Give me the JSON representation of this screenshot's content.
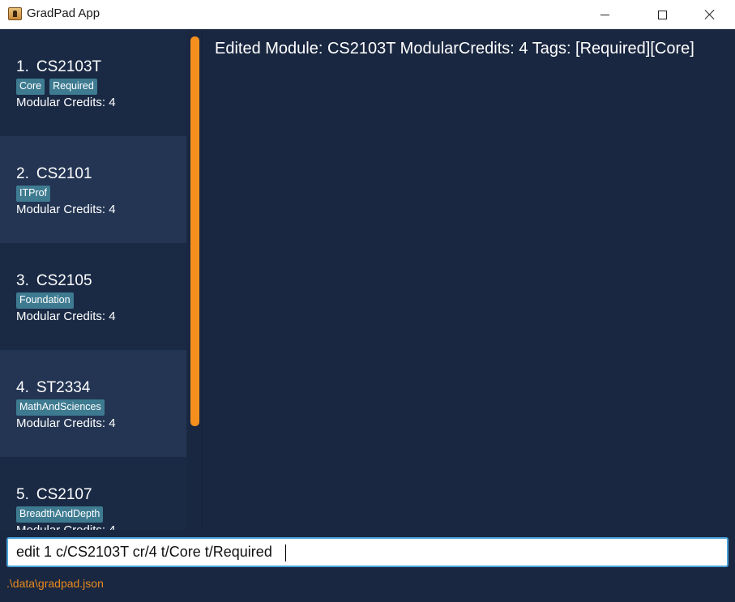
{
  "window": {
    "title": "GradPad App"
  },
  "modules": [
    {
      "index": "1.",
      "code": "CS2103T",
      "tags": [
        "Core",
        "Required"
      ],
      "credits": "Modular Credits: 4"
    },
    {
      "index": "2.",
      "code": "CS2101",
      "tags": [
        "ITProf"
      ],
      "credits": "Modular Credits: 4"
    },
    {
      "index": "3.",
      "code": "CS2105",
      "tags": [
        "Foundation"
      ],
      "credits": "Modular Credits: 4"
    },
    {
      "index": "4.",
      "code": "ST2334",
      "tags": [
        "MathAndSciences"
      ],
      "credits": "Modular Credits: 4"
    },
    {
      "index": "5.",
      "code": "CS2107",
      "tags": [
        "BreadthAndDepth"
      ],
      "credits": "Modular Credits: 4"
    }
  ],
  "result": {
    "text": "Edited Module: CS2103T ModularCredits: 4 Tags: [Required][Core]"
  },
  "command": {
    "value": "edit 1 c/CS2103T cr/4 t/Core t/Required"
  },
  "status": {
    "file_path": ".\\data\\gradpad.json"
  },
  "colors": {
    "background": "#1a2741",
    "card_odd": "#1a2a45",
    "card_even": "#233553",
    "tag": "#3e7b91",
    "scrollbar": "#f5901e",
    "status_text": "#e88a1c"
  }
}
